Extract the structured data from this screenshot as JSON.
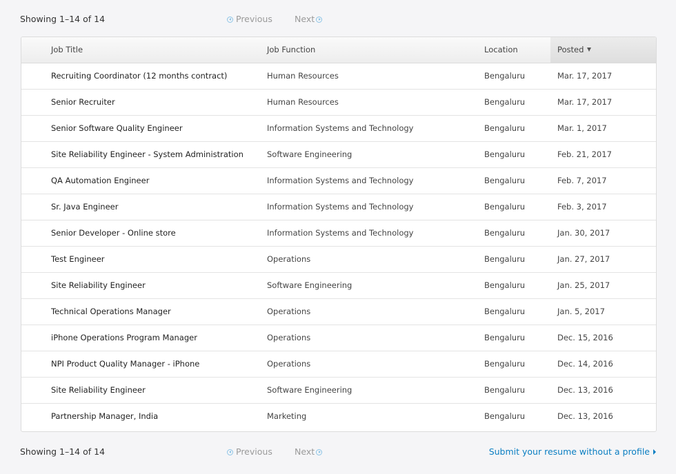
{
  "pager": {
    "showing": "Showing 1–14 of 14",
    "previous": "Previous",
    "next": "Next"
  },
  "table": {
    "headers": {
      "title": "Job Title",
      "function": "Job Function",
      "location": "Location",
      "posted": "Posted"
    },
    "sorted_by": "posted",
    "sort_direction": "descending",
    "rows": [
      {
        "title": "Recruiting Coordinator (12 months contract)",
        "function": "Human Resources",
        "location": "Bengaluru",
        "posted": "Mar. 17, 2017"
      },
      {
        "title": "Senior Recruiter",
        "function": "Human Resources",
        "location": "Bengaluru",
        "posted": "Mar. 17, 2017"
      },
      {
        "title": "Senior Software Quality Engineer",
        "function": "Information Systems and Technology",
        "location": "Bengaluru",
        "posted": "Mar. 1, 2017"
      },
      {
        "title": "Site Reliability Engineer - System Administration",
        "function": "Software Engineering",
        "location": "Bengaluru",
        "posted": "Feb. 21, 2017"
      },
      {
        "title": "QA Automation Engineer",
        "function": "Information Systems and Technology",
        "location": "Bengaluru",
        "posted": "Feb. 7, 2017"
      },
      {
        "title": "Sr. Java Engineer",
        "function": "Information Systems and Technology",
        "location": "Bengaluru",
        "posted": "Feb. 3, 2017"
      },
      {
        "title": "Senior Developer - Online store",
        "function": "Information Systems and Technology",
        "location": "Bengaluru",
        "posted": "Jan. 30, 2017"
      },
      {
        "title": "Test Engineer",
        "function": "Operations",
        "location": "Bengaluru",
        "posted": "Jan. 27, 2017"
      },
      {
        "title": "Site Reliability Engineer",
        "function": "Software Engineering",
        "location": "Bengaluru",
        "posted": "Jan. 25, 2017"
      },
      {
        "title": "Technical Operations Manager",
        "function": "Operations",
        "location": "Bengaluru",
        "posted": "Jan. 5, 2017"
      },
      {
        "title": "iPhone Operations Program Manager",
        "function": "Operations",
        "location": "Bengaluru",
        "posted": "Dec. 15, 2016"
      },
      {
        "title": "NPI Product Quality Manager - iPhone",
        "function": "Operations",
        "location": "Bengaluru",
        "posted": "Dec. 14, 2016"
      },
      {
        "title": "Site Reliability Engineer",
        "function": "Software Engineering",
        "location": "Bengaluru",
        "posted": "Dec. 13, 2016"
      },
      {
        "title": "Partnership Manager, India",
        "function": "Marketing",
        "location": "Bengaluru",
        "posted": "Dec. 13, 2016"
      }
    ]
  },
  "footer": {
    "submit_link": "Submit your resume without a profile"
  },
  "colors": {
    "link": "#0a7ec2",
    "disabled": "#9a9a9a",
    "pager_icon": "#8cc4e6"
  }
}
